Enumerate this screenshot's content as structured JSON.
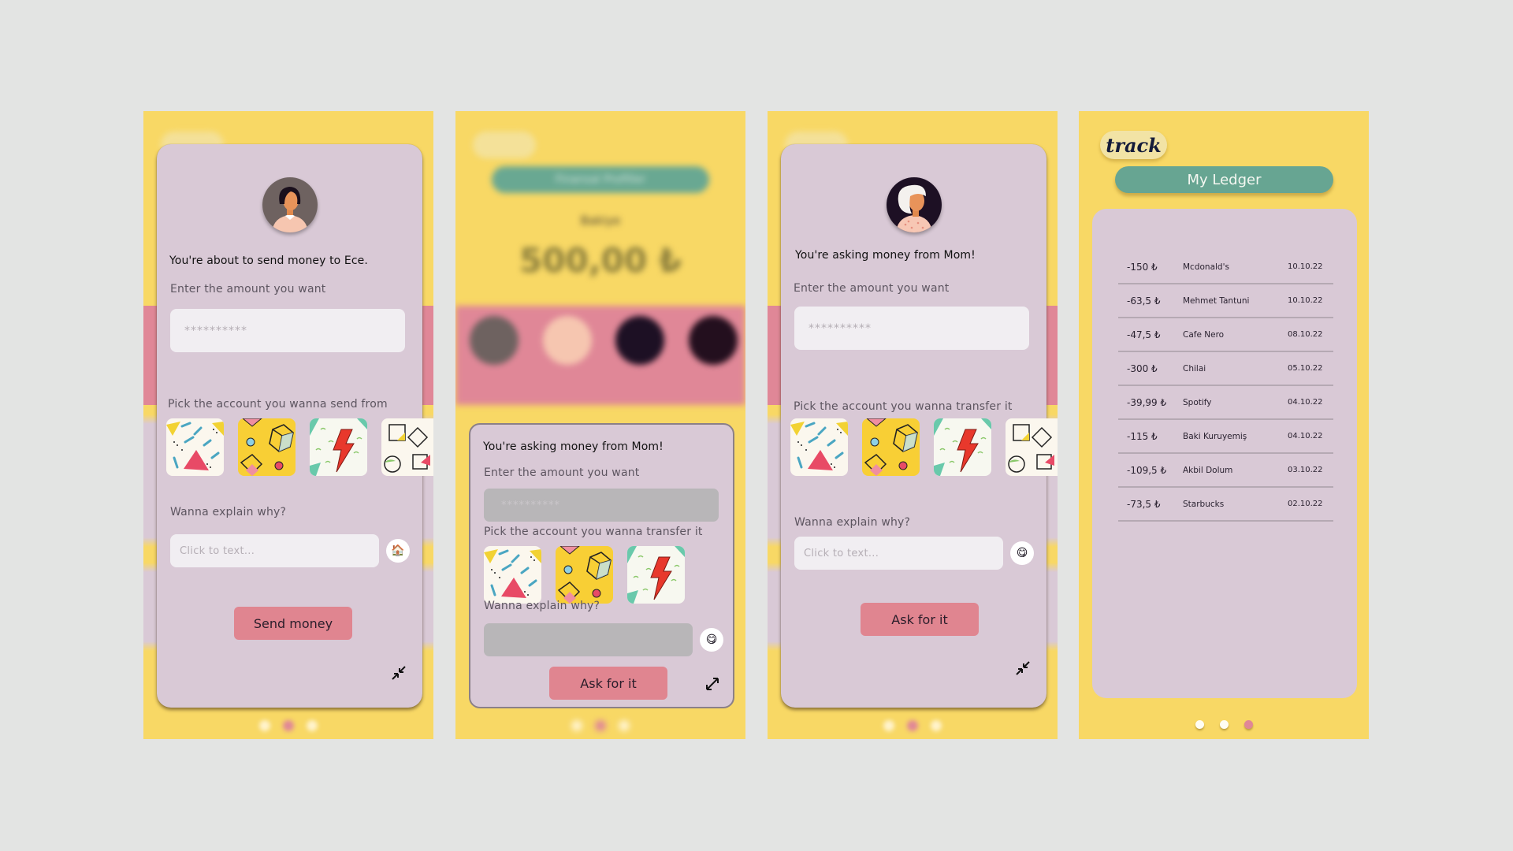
{
  "colors": {
    "background": "#e3e4e3",
    "yellow": "#f8d865",
    "pink": "#e08797",
    "card": "#d9c9d6",
    "green": "#67a592",
    "button": "#e08590"
  },
  "screen_send": {
    "recipient_avatar": "woman-short-black-hair-avatar",
    "title": "You're about to send money to Ece.",
    "amount_label": "Enter the amount you want",
    "amount_placeholder": "**********",
    "account_label": "Pick the account you wanna send from",
    "accounts": [
      "memphis-triangle-card",
      "yellow-cube-card",
      "lightning-card",
      "geometric-shapes-card"
    ],
    "explain_label": "Wanna explain why?",
    "explain_placeholder": "Click to text...",
    "emoji": "🏠",
    "submit_label": "Send money",
    "corner_icon": "collapse-icon",
    "page_dots": {
      "count": 3,
      "active": 1
    }
  },
  "screen_request_popup": {
    "background": {
      "header_pill": "Finansal Profiller",
      "balance_label": "Bakiye",
      "balance_value": "500,00 ₺",
      "friends": [
        "friend-1",
        "friend-2",
        "friend-3",
        "friend-4"
      ]
    },
    "title": "You're asking money from Mom!",
    "amount_label": "Enter the amount you want",
    "amount_placeholder": "**********",
    "account_label": "Pick the account you wanna transfer it",
    "accounts": [
      "memphis-triangle-card",
      "yellow-cube-card",
      "lightning-card"
    ],
    "explain_label": "Wanna explain why?",
    "emoji": "😋",
    "submit_label": "Ask for it",
    "corner_icon": "expand-icon"
  },
  "screen_request": {
    "recipient_avatar": "woman-white-hair-avatar",
    "title": "You're asking money from Mom!",
    "amount_label": "Enter the amount you want",
    "amount_placeholder": "**********",
    "account_label": "Pick the account you wanna transfer it",
    "accounts": [
      "memphis-triangle-card",
      "yellow-cube-card",
      "lightning-card",
      "geometric-shapes-card"
    ],
    "explain_label": "Wanna explain why?",
    "explain_placeholder": "Click to text...",
    "emoji": "😋",
    "submit_label": "Ask for it",
    "corner_icon": "collapse-icon",
    "page_dots": {
      "count": 3,
      "active": 1
    }
  },
  "screen_ledger": {
    "logo": "track",
    "title": "My Ledger",
    "entries": [
      {
        "amount": "-150 ₺",
        "merchant": "Mcdonald's",
        "date": "10.10.22"
      },
      {
        "amount": "-63,5 ₺",
        "merchant": "Mehmet Tantuni",
        "date": "10.10.22"
      },
      {
        "amount": "-47,5 ₺",
        "merchant": "Cafe Nero",
        "date": "08.10.22"
      },
      {
        "amount": "-300 ₺",
        "merchant": "Chilai",
        "date": "05.10.22"
      },
      {
        "amount": "-39,99 ₺",
        "merchant": "Spotify",
        "date": "04.10.22"
      },
      {
        "amount": "-115 ₺",
        "merchant": "Baki Kuruyemiş",
        "date": "04.10.22"
      },
      {
        "amount": "-109,5 ₺",
        "merchant": "Akbil Dolum",
        "date": "03.10.22"
      },
      {
        "amount": "-73,5 ₺",
        "merchant": "Starbucks",
        "date": "02.10.22"
      }
    ],
    "page_dots": {
      "count": 3,
      "active": 2
    }
  }
}
